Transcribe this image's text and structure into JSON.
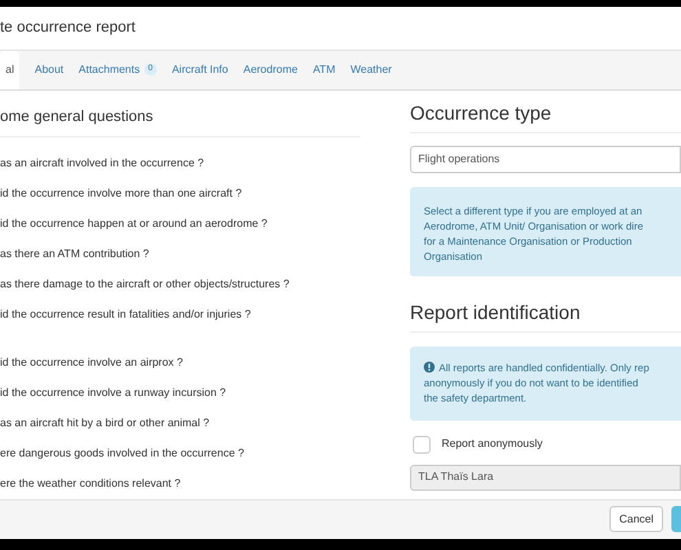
{
  "window": {
    "title": "te occurrence report"
  },
  "tabs": [
    {
      "label": "al",
      "selected": true
    },
    {
      "label": "About",
      "selected": false
    },
    {
      "label": "Attachments",
      "badge": "0",
      "selected": false
    },
    {
      "label": "Aircraft Info",
      "selected": false
    },
    {
      "label": "Aerodrome",
      "selected": false
    },
    {
      "label": "ATM",
      "selected": false
    },
    {
      "label": "Weather",
      "selected": false
    }
  ],
  "questions": {
    "heading": "ome general questions",
    "groups": [
      [
        "as an aircraft involved in the occurrence ?",
        "id the occurrence involve more than one aircraft ?",
        "id the occurrence happen at or around an aerodrome ?",
        "as there an ATM contribution ?",
        "as there damage to the aircraft or other objects/structures ?",
        "id the occurrence result in fatalities and/or injuries ?"
      ],
      [
        "id the occurrence involve an airprox ?",
        "id the occurrence involve a runway incursion ?",
        "as an aircraft hit by a bird or other animal ?",
        "ere dangerous goods involved in the occurrence ?",
        "ere the weather conditions relevant ?"
      ]
    ]
  },
  "occurrence_type": {
    "heading": "Occurrence type",
    "value": "Flight operations",
    "info_lines": [
      "Select a different type if you are employed at an",
      "Aerodrome, ATM Unit/ Organisation or work dire",
      "for a Maintenance Organisation or Production",
      "Organisation"
    ]
  },
  "report_identification": {
    "heading": "Report identification",
    "info_lines": [
      "All reports are handled confidentially. Only rep",
      "anonymously if you do not want to be identified",
      "the safety department."
    ],
    "anonymous": {
      "label": "Report anonymously",
      "checked": false
    },
    "reporter": "TLA Thaïs Lara"
  },
  "buttons": [
    "Cancel"
  ]
}
